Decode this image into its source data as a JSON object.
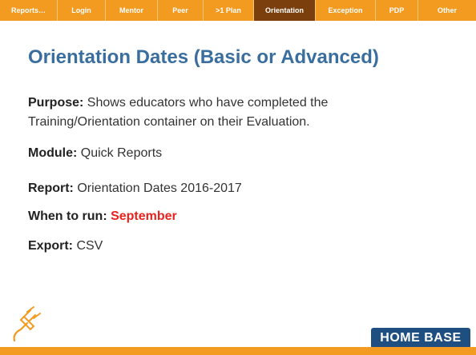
{
  "tabs": [
    {
      "label": "Reports…",
      "active": false
    },
    {
      "label": "Login",
      "active": false
    },
    {
      "label": "Mentor",
      "active": false
    },
    {
      "label": "Peer",
      "active": false
    },
    {
      "label": ">1 Plan",
      "active": false
    },
    {
      "label": "Orientation",
      "active": true
    },
    {
      "label": "Exception",
      "active": false
    },
    {
      "label": "PDP",
      "active": false
    },
    {
      "label": "Other",
      "active": false
    }
  ],
  "title": "Orientation Dates (Basic or Advanced)",
  "purpose": {
    "label": "Purpose:",
    "line1": " Shows educators who have completed the",
    "line2": "Training/Orientation container on their Evaluation."
  },
  "module": {
    "label": "Module:",
    "value": " Quick Reports"
  },
  "report": {
    "label": "Report:",
    "value": " Orientation Dates 2016-2017"
  },
  "when": {
    "label": "When to run:",
    "value": " September"
  },
  "export": {
    "label": "Export:",
    "value": " CSV"
  },
  "logo": "HOME BASE",
  "colors": {
    "accent": "#f39a20",
    "active_tab": "#7a3f0d",
    "title": "#3a6e9e",
    "highlight": "#e8231e"
  },
  "icons": {
    "plug": "plug-icon"
  }
}
